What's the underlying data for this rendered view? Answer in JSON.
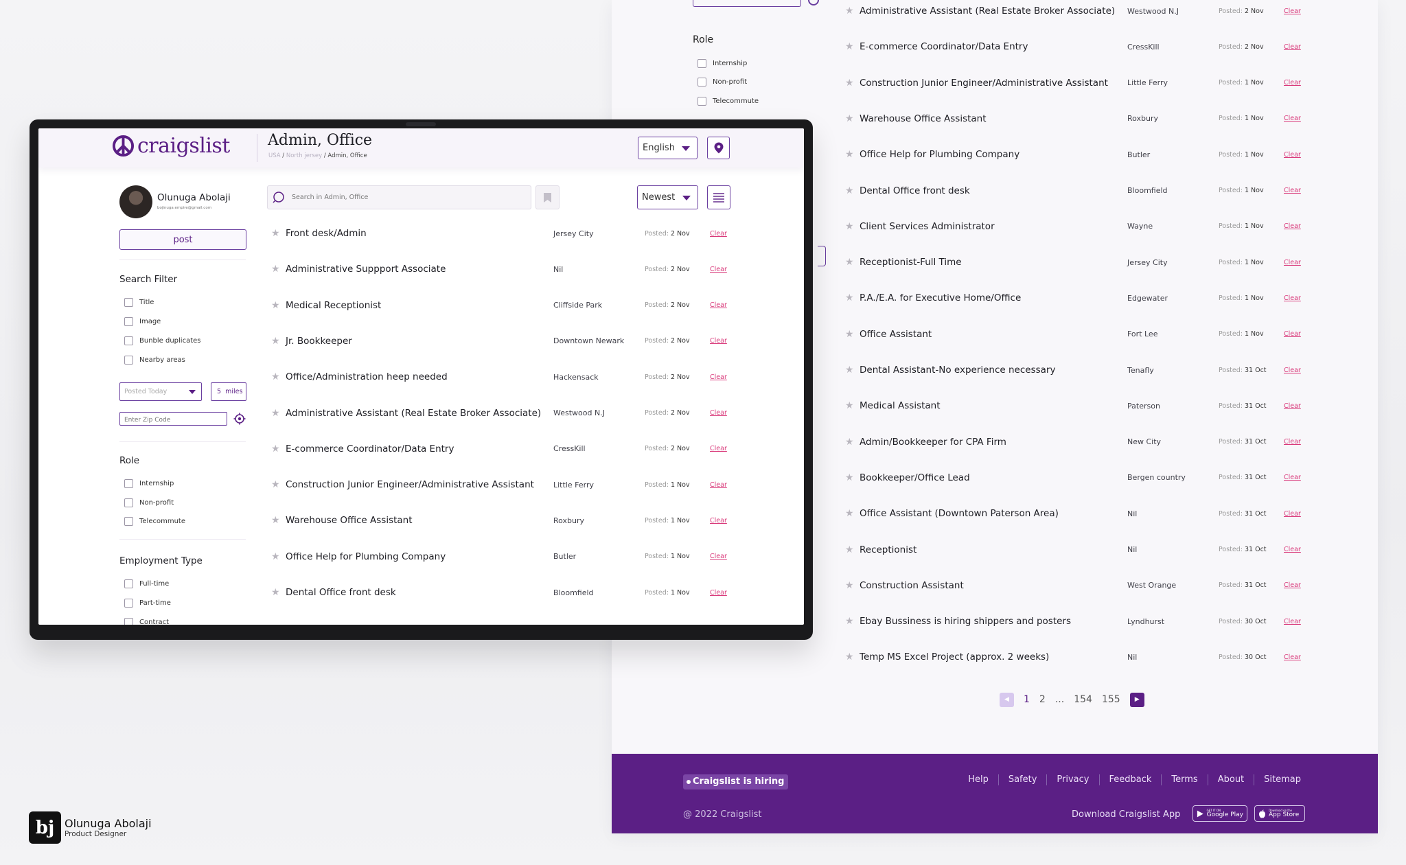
{
  "colors": {
    "brand": "#5b1f85",
    "accent_border": "#6a3fa0",
    "clear_link": "#d9397a",
    "footer_bg": "#5b1f85"
  },
  "header": {
    "logo_text": "craigslist",
    "logo_icon": "peace-icon",
    "page_title": "Admin, Office",
    "breadcrumb": [
      "USA",
      "North jersey",
      "Admin, Office"
    ],
    "language": "English"
  },
  "user": {
    "name": "Olunuga Abolaji",
    "email": "bojinuga.empire@gmail.com"
  },
  "sidebar": {
    "post_label": "post",
    "search_filter_title": "Search Filter",
    "search_filters": [
      "Title",
      "Image",
      "Bunble duplicates",
      "Nearby areas"
    ],
    "posted_select": "Posted Today",
    "miles_value": "5",
    "miles_unit": "miles",
    "zip_placeholder": "Enter Zip Code",
    "role_title": "Role",
    "roles": [
      "Internship",
      "Non-profit",
      "Telecommute"
    ],
    "employment_title": "Employment Type",
    "employment_types": [
      "Full-time",
      "Part-time",
      "Contract"
    ]
  },
  "toolbar": {
    "search_placeholder": "Search in Admin, Office",
    "sort": "Newest"
  },
  "posted_label": "Posted:",
  "clear_label": "Clear",
  "listings": [
    {
      "title": "Front desk/Admin",
      "location": "Jersey City",
      "posted": "2 Nov"
    },
    {
      "title": "Administrative Suppport Associate",
      "location": "Nil",
      "posted": "2 Nov"
    },
    {
      "title": "Medical Receptionist",
      "location": "Cliffside Park",
      "posted": "2 Nov"
    },
    {
      "title": "Jr. Bookkeeper",
      "location": "Downtown Newark",
      "posted": "2 Nov"
    },
    {
      "title": "Office/Administration heep needed",
      "location": "Hackensack",
      "posted": "2 Nov"
    },
    {
      "title": "Administrative Assistant (Real Estate Broker Associate)",
      "location": "Westwood N.J",
      "posted": "2 Nov"
    },
    {
      "title": "E-commerce Coordinator/Data Entry",
      "location": "CressKill",
      "posted": "2 Nov"
    },
    {
      "title": "Construction Junior Engineer/Administrative Assistant",
      "location": "Little Ferry",
      "posted": "1 Nov"
    },
    {
      "title": "Warehouse Office Assistant",
      "location": "Roxbury",
      "posted": "1 Nov"
    },
    {
      "title": "Office Help for Plumbing Company",
      "location": "Butler",
      "posted": "1 Nov"
    },
    {
      "title": "Dental Office front desk",
      "location": "Bloomfield",
      "posted": "1 Nov"
    },
    {
      "title": "Client Services Administrator",
      "location": "Wayne",
      "posted": "1 Nov"
    },
    {
      "title": "Receptionist-Full Time",
      "location": "Jersey City",
      "posted": "1 Nov"
    },
    {
      "title": "P.A./E.A. for Executive Home/Office",
      "location": "Edgewater",
      "posted": "1 Nov"
    },
    {
      "title": "Office Assistant",
      "location": "Fort Lee",
      "posted": "1 Nov"
    },
    {
      "title": "Dental Assistant-No experience necessary",
      "location": "Tenafly",
      "posted": "31 Oct"
    },
    {
      "title": "Medical Assistant",
      "location": "Paterson",
      "posted": "31 Oct"
    },
    {
      "title": "Admin/Bookkeeper for CPA Firm",
      "location": "New City",
      "posted": "31 Oct"
    },
    {
      "title": "Bookkeeper/Office Lead",
      "location": "Bergen country",
      "posted": "31 Oct"
    },
    {
      "title": "Office Assistant (Downtown Paterson Area)",
      "location": "Nil",
      "posted": "31 Oct"
    },
    {
      "title": "Receptionist",
      "location": "Nil",
      "posted": "31 Oct"
    },
    {
      "title": "Construction Assistant",
      "location": "West Orange",
      "posted": "31 Oct"
    },
    {
      "title": "Ebay Bussiness is hiring shippers and posters",
      "location": "Lyndhurst",
      "posted": "30 Oct"
    },
    {
      "title": "Temp MS Excel Project (approx. 2 weeks)",
      "location": "Nil",
      "posted": "30 Oct"
    }
  ],
  "pagination": {
    "pages": [
      "1",
      "2",
      "...",
      "154",
      "155"
    ],
    "current": "1"
  },
  "footer": {
    "hiring_badge": "Craigslist is hiring",
    "copyright": "@ 2022 Craigslist",
    "links": [
      "Help",
      "Safety",
      "Privacy",
      "Feedback",
      "Terms",
      "About",
      "Sitemap"
    ],
    "download_label": "Download Craigslist App",
    "google_play": {
      "small": "GET IT ON",
      "big": "Google Play"
    },
    "app_store": {
      "small": "Download on the",
      "big": "App Store"
    }
  },
  "designer": {
    "logo_text": "bj",
    "name": "Olunuga Abolaji",
    "role": "Product Designer"
  }
}
